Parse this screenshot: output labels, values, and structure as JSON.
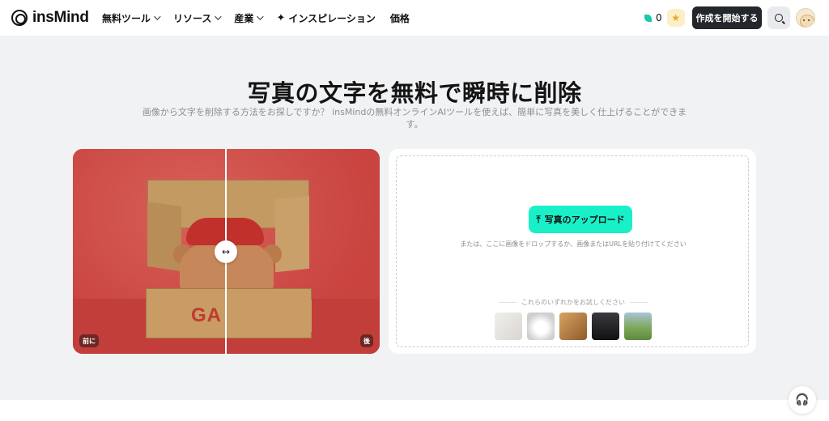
{
  "brand": {
    "name": "insMind"
  },
  "nav": {
    "items": [
      {
        "label": "無料ツール",
        "dropdown": true
      },
      {
        "label": "リソース",
        "dropdown": true
      },
      {
        "label": "産業",
        "dropdown": true
      },
      {
        "label": "インスピレーション",
        "icon": "sparkle-icon"
      },
      {
        "label": "価格"
      }
    ],
    "credits": "0",
    "cta_label": "作成を開始する"
  },
  "hero": {
    "title": "写真の文字を無料で瞬時に削除",
    "subtitle": "画像から文字を削除する方法をお探しですか？ insMindの無料オンラインAIツールを使えば、簡単に写真を美しく仕上げることができます。"
  },
  "compare": {
    "before_label": "前に",
    "after_label": "後",
    "box_text": "GA"
  },
  "upload": {
    "button_label": "写真のアップロード",
    "hint": "または、ここに画像をドロップするか、画像またはURLを貼り付けてください",
    "try_label": "これらのいずれかをお試しください",
    "samples": [
      "handwriting-sample",
      "tshirt-sample",
      "cafe-sample",
      "laptop-sample",
      "field-sample"
    ]
  },
  "colors": {
    "accent": "#19f0c8",
    "cta": "#23262b",
    "background": "#f1f2f4"
  }
}
